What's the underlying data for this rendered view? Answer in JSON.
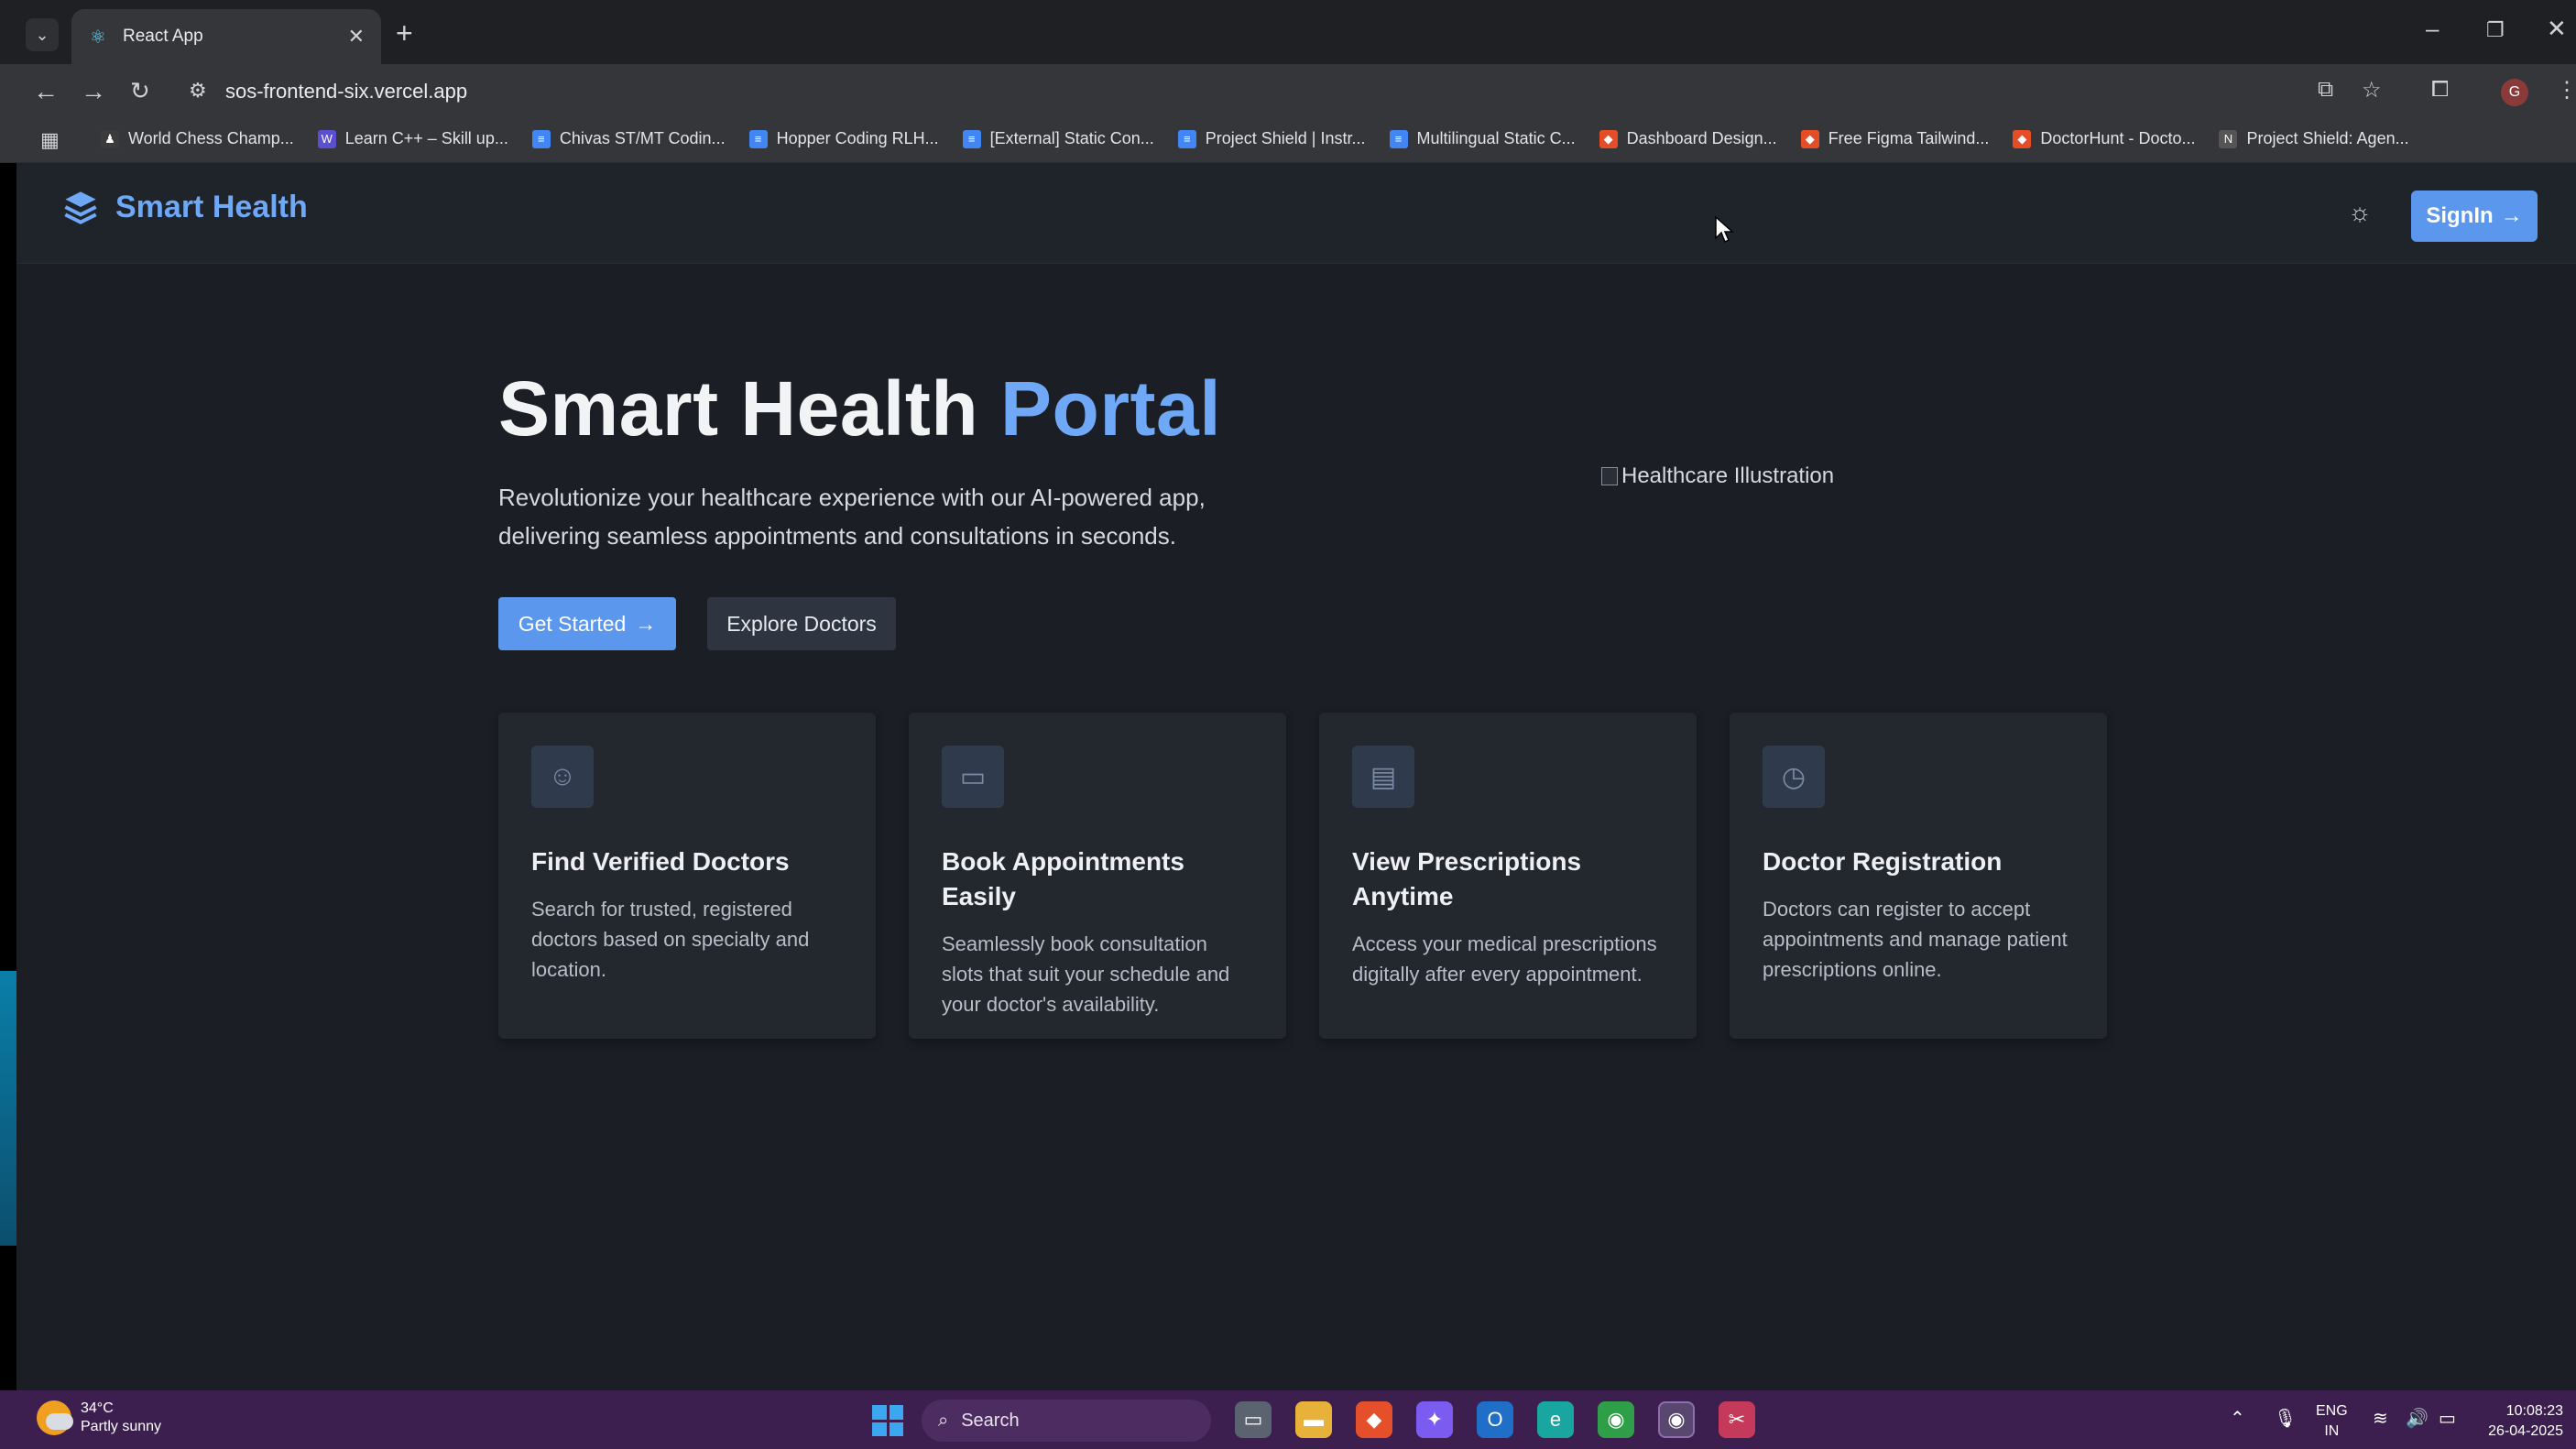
{
  "browser": {
    "tab_title": "React App",
    "url": "sos-frontend-six.vercel.app",
    "bookmarks": [
      {
        "label": "World Chess Champ...",
        "color": "#3b3b3b",
        "glyph": "♟"
      },
      {
        "label": "Learn C++ – Skill up...",
        "color": "#5a4fcf",
        "glyph": "W"
      },
      {
        "label": "Chivas ST/MT Codin...",
        "color": "#4285f4",
        "glyph": "≡"
      },
      {
        "label": "Hopper Coding RLH...",
        "color": "#4285f4",
        "glyph": "≡"
      },
      {
        "label": "[External] Static Con...",
        "color": "#4285f4",
        "glyph": "≡"
      },
      {
        "label": "Project Shield | Instr...",
        "color": "#4285f4",
        "glyph": "≡"
      },
      {
        "label": "Multilingual Static C...",
        "color": "#4285f4",
        "glyph": "≡"
      },
      {
        "label": "Dashboard Design...",
        "color": "#e44d26",
        "glyph": "◆"
      },
      {
        "label": "Free Figma Tailwind...",
        "color": "#e44d26",
        "glyph": "◆"
      },
      {
        "label": "DoctorHunt - Docto...",
        "color": "#e44d26",
        "glyph": "◆"
      },
      {
        "label": "Project Shield: Agen...",
        "color": "#555555",
        "glyph": "N"
      }
    ],
    "profile_initial": "G"
  },
  "header": {
    "brand": "Smart Health",
    "signin_label": "SignIn",
    "signin_arrow": "→"
  },
  "hero": {
    "title_main": "Smart Health",
    "title_accent": "Portal",
    "subtitle": "Revolutionize your healthcare experience with our AI-powered app, delivering seamless appointments and consultations in seconds.",
    "primary_cta": "Get Started",
    "primary_arrow": "→",
    "secondary_cta": "Explore Doctors",
    "image_alt": "Healthcare Illustration"
  },
  "features": [
    {
      "icon": "smile-icon",
      "glyph": "☺",
      "title": "Find Verified Doctors",
      "text": "Search for trusted, registered doctors based on specialty and location."
    },
    {
      "icon": "calendar-icon",
      "glyph": "▭",
      "title": "Book Appointments Easily",
      "text": "Seamlessly book consultation slots that suit your schedule and your doctor's availability."
    },
    {
      "icon": "document-icon",
      "glyph": "▤",
      "title": "View Prescriptions Anytime",
      "text": "Access your medical prescriptions digitally after every appointment."
    },
    {
      "icon": "clock-icon",
      "glyph": "◷",
      "title": "Doctor Registration",
      "text": "Doctors can register to accept appointments and manage patient prescriptions online."
    }
  ],
  "taskbar": {
    "temperature": "34°C",
    "weather": "Partly sunny",
    "search_placeholder": "Search",
    "lang_top": "ENG",
    "lang_bottom": "IN",
    "time": "10:08:23",
    "date": "26-04-2025"
  },
  "colors": {
    "accent": "#6ea8f7",
    "button": "#5b97ec",
    "background": "#1b1e24",
    "taskbar": "#3c1e4f"
  }
}
